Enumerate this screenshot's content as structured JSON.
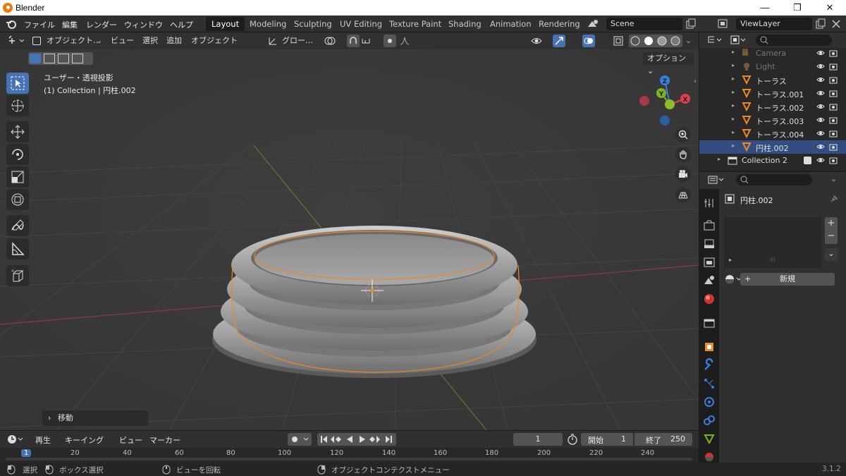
{
  "window": {
    "title": "Blender"
  },
  "topbar": {
    "menus": [
      "ファイル",
      "編集",
      "レンダー",
      "ウィンドウ",
      "ヘルプ"
    ],
    "workspaces": [
      "Layout",
      "Modeling",
      "Sculpting",
      "UV Editing",
      "Texture Paint",
      "Shading",
      "Animation",
      "Rendering"
    ],
    "active_workspace": "Layout",
    "scene": "Scene",
    "view_layer": "ViewLayer"
  },
  "viewport": {
    "mode": "オブジェクト…",
    "menus": [
      "ビュー",
      "選択",
      "追加",
      "オブジェクト"
    ],
    "transform_orientation": "グロー…",
    "options_label": "オプション",
    "overlay_title": "ユーザー・透視投影",
    "overlay_subtitle": "(1) Collection | 円柱.002",
    "last_operator": "移動",
    "gizmo_axes": {
      "x": "X",
      "y": "Y",
      "z": "Z"
    }
  },
  "outliner": {
    "rows": [
      {
        "label": "Camera",
        "dim": true,
        "icon": "camera-icon"
      },
      {
        "label": "Light",
        "dim": true,
        "icon": "light-icon"
      },
      {
        "label": "トーラス",
        "dim": false,
        "icon": "mesh-icon"
      },
      {
        "label": "トーラス.001",
        "dim": false,
        "icon": "mesh-icon"
      },
      {
        "label": "トーラス.002",
        "dim": false,
        "icon": "mesh-icon"
      },
      {
        "label": "トーラス.003",
        "dim": false,
        "icon": "mesh-icon"
      },
      {
        "label": "トーラス.004",
        "dim": false,
        "icon": "mesh-icon"
      },
      {
        "label": "円柱.002",
        "dim": false,
        "selected": true,
        "icon": "mesh-icon"
      },
      {
        "label": "Collection 2",
        "dim": false,
        "icon": "collection-icon"
      }
    ]
  },
  "properties": {
    "object_name": "円柱.002",
    "new_button": "新規"
  },
  "timeline": {
    "menus": [
      "再生",
      "キーイング",
      "ビュー",
      "マーカー"
    ],
    "current_frame": "1",
    "start_label": "開始",
    "start_value": "1",
    "end_label": "終了",
    "end_value": "250",
    "ruler": [
      "1",
      "20",
      "40",
      "60",
      "80",
      "100",
      "120",
      "140",
      "160",
      "180",
      "200",
      "220",
      "240"
    ]
  },
  "statusbar": {
    "items": [
      "選択",
      "ボックス選択",
      "ビューを回転",
      "オブジェクトコンテクストメニュー"
    ],
    "version": "3.1.2"
  },
  "colors": {
    "accent": "#4772b3",
    "selection_outline": "#e8892a",
    "mesh_icon": "#e8892a",
    "axis_x": "#e0404e",
    "axis_y": "#7ab51e",
    "axis_z": "#3a7fdd"
  }
}
